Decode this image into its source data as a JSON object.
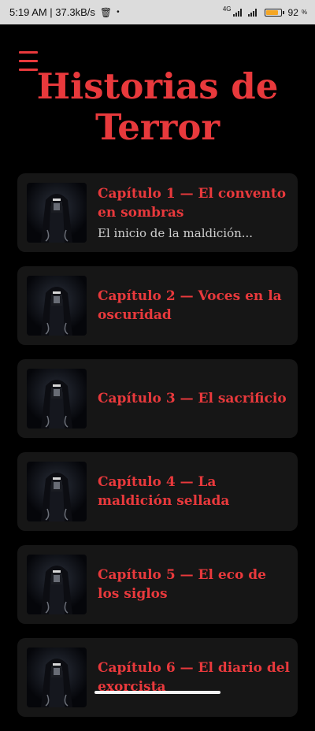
{
  "status_bar": {
    "time_speed": "5:19 AM | 37.3kB/s",
    "network": "4G",
    "battery_percent": "92",
    "battery_level": 0.92
  },
  "header": {
    "menu_icon": "hamburger-menu-icon",
    "title": "Historias de Terror"
  },
  "chapters": [
    {
      "title": "Capítulo 1 — El convento en sombras",
      "subtitle": "El inicio de la maldición..."
    },
    {
      "title": "Capítulo 2 — Voces en la oscuridad",
      "subtitle": ""
    },
    {
      "title": "Capítulo 3 — El sacrificio",
      "subtitle": ""
    },
    {
      "title": "Capítulo 4 — La maldición sellada",
      "subtitle": ""
    },
    {
      "title": "Capítulo 5 — El eco de los siglos",
      "subtitle": ""
    },
    {
      "title": "Capítulo 6 — El diario del exorcista",
      "subtitle": ""
    }
  ],
  "colors": {
    "accent": "#e8393c",
    "background": "#000000",
    "card": "#161616"
  }
}
